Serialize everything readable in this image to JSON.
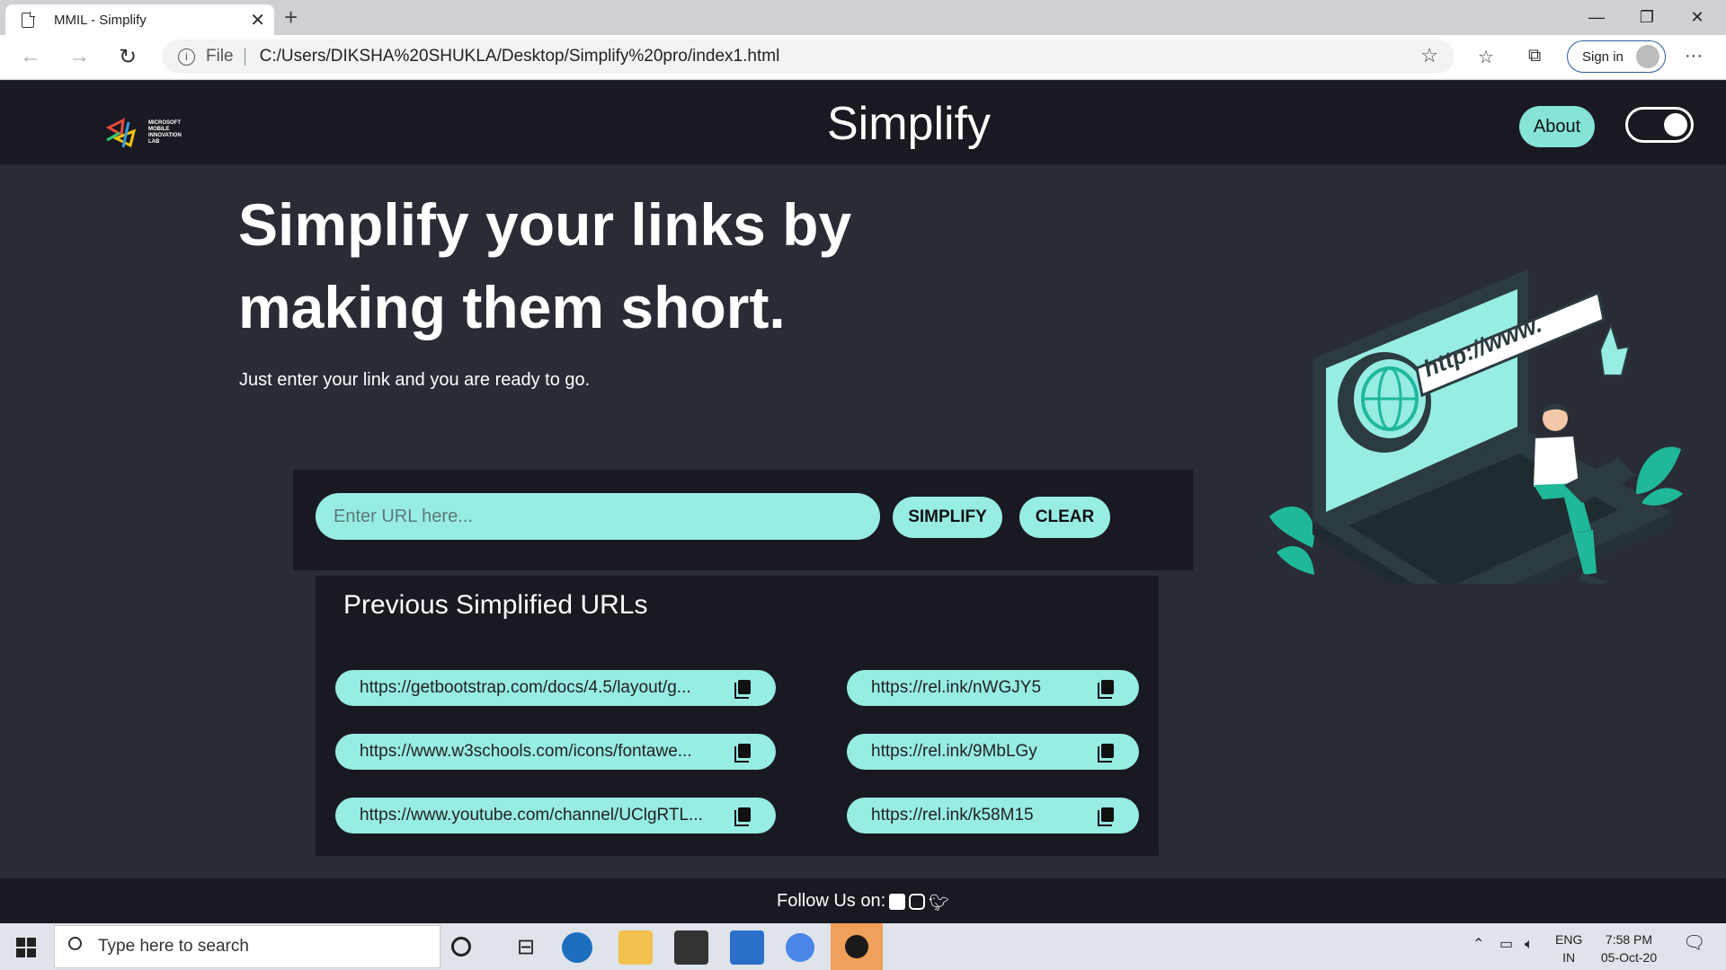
{
  "browser": {
    "tab_title": "MMIL - Simplify",
    "tab_close": "✕",
    "new_tab": "+",
    "url_scheme_label": "File",
    "url": "C:/Users/DIKSHA%20SHUKLA/Desktop/Simplify%20pro/index1.html",
    "signin_label": "Sign in",
    "minimize": "—",
    "restore": "❐",
    "close": "✕"
  },
  "header": {
    "logo_text": "MICROSOFT MOBILE INNOVATION LAB",
    "brand": "Simplify",
    "about_label": "About"
  },
  "hero": {
    "title": "Simplify your links by making them short.",
    "subtitle": "Just enter your link and you are ready to go."
  },
  "form": {
    "placeholder": "Enter URL here...",
    "simplify_label": "SIMPLIFY",
    "clear_label": "CLEAR"
  },
  "history": {
    "title": "Previous Simplified URLs",
    "rows": [
      {
        "long": "https://getbootstrap.com/docs/4.5/layout/g...",
        "short": "https://rel.ink/nWGJY5"
      },
      {
        "long": "https://www.w3schools.com/icons/fontawe...",
        "short": "https://rel.ink/9MbLGy"
      },
      {
        "long": "https://www.youtube.com/channel/UClgRTL...",
        "short": "https://rel.ink/k58M15"
      }
    ]
  },
  "illustration": {
    "banner_text": "http://www."
  },
  "footer": {
    "follow_label": "Follow Us on:"
  },
  "taskbar": {
    "search_placeholder": "Type here to search",
    "lang_top": "ENG",
    "lang_bottom": "IN",
    "time": "7:58 PM",
    "date": "05-Oct-20"
  },
  "colors": {
    "accent": "#97ece4",
    "header_bg": "#181921",
    "page_bg": "#292c35"
  }
}
